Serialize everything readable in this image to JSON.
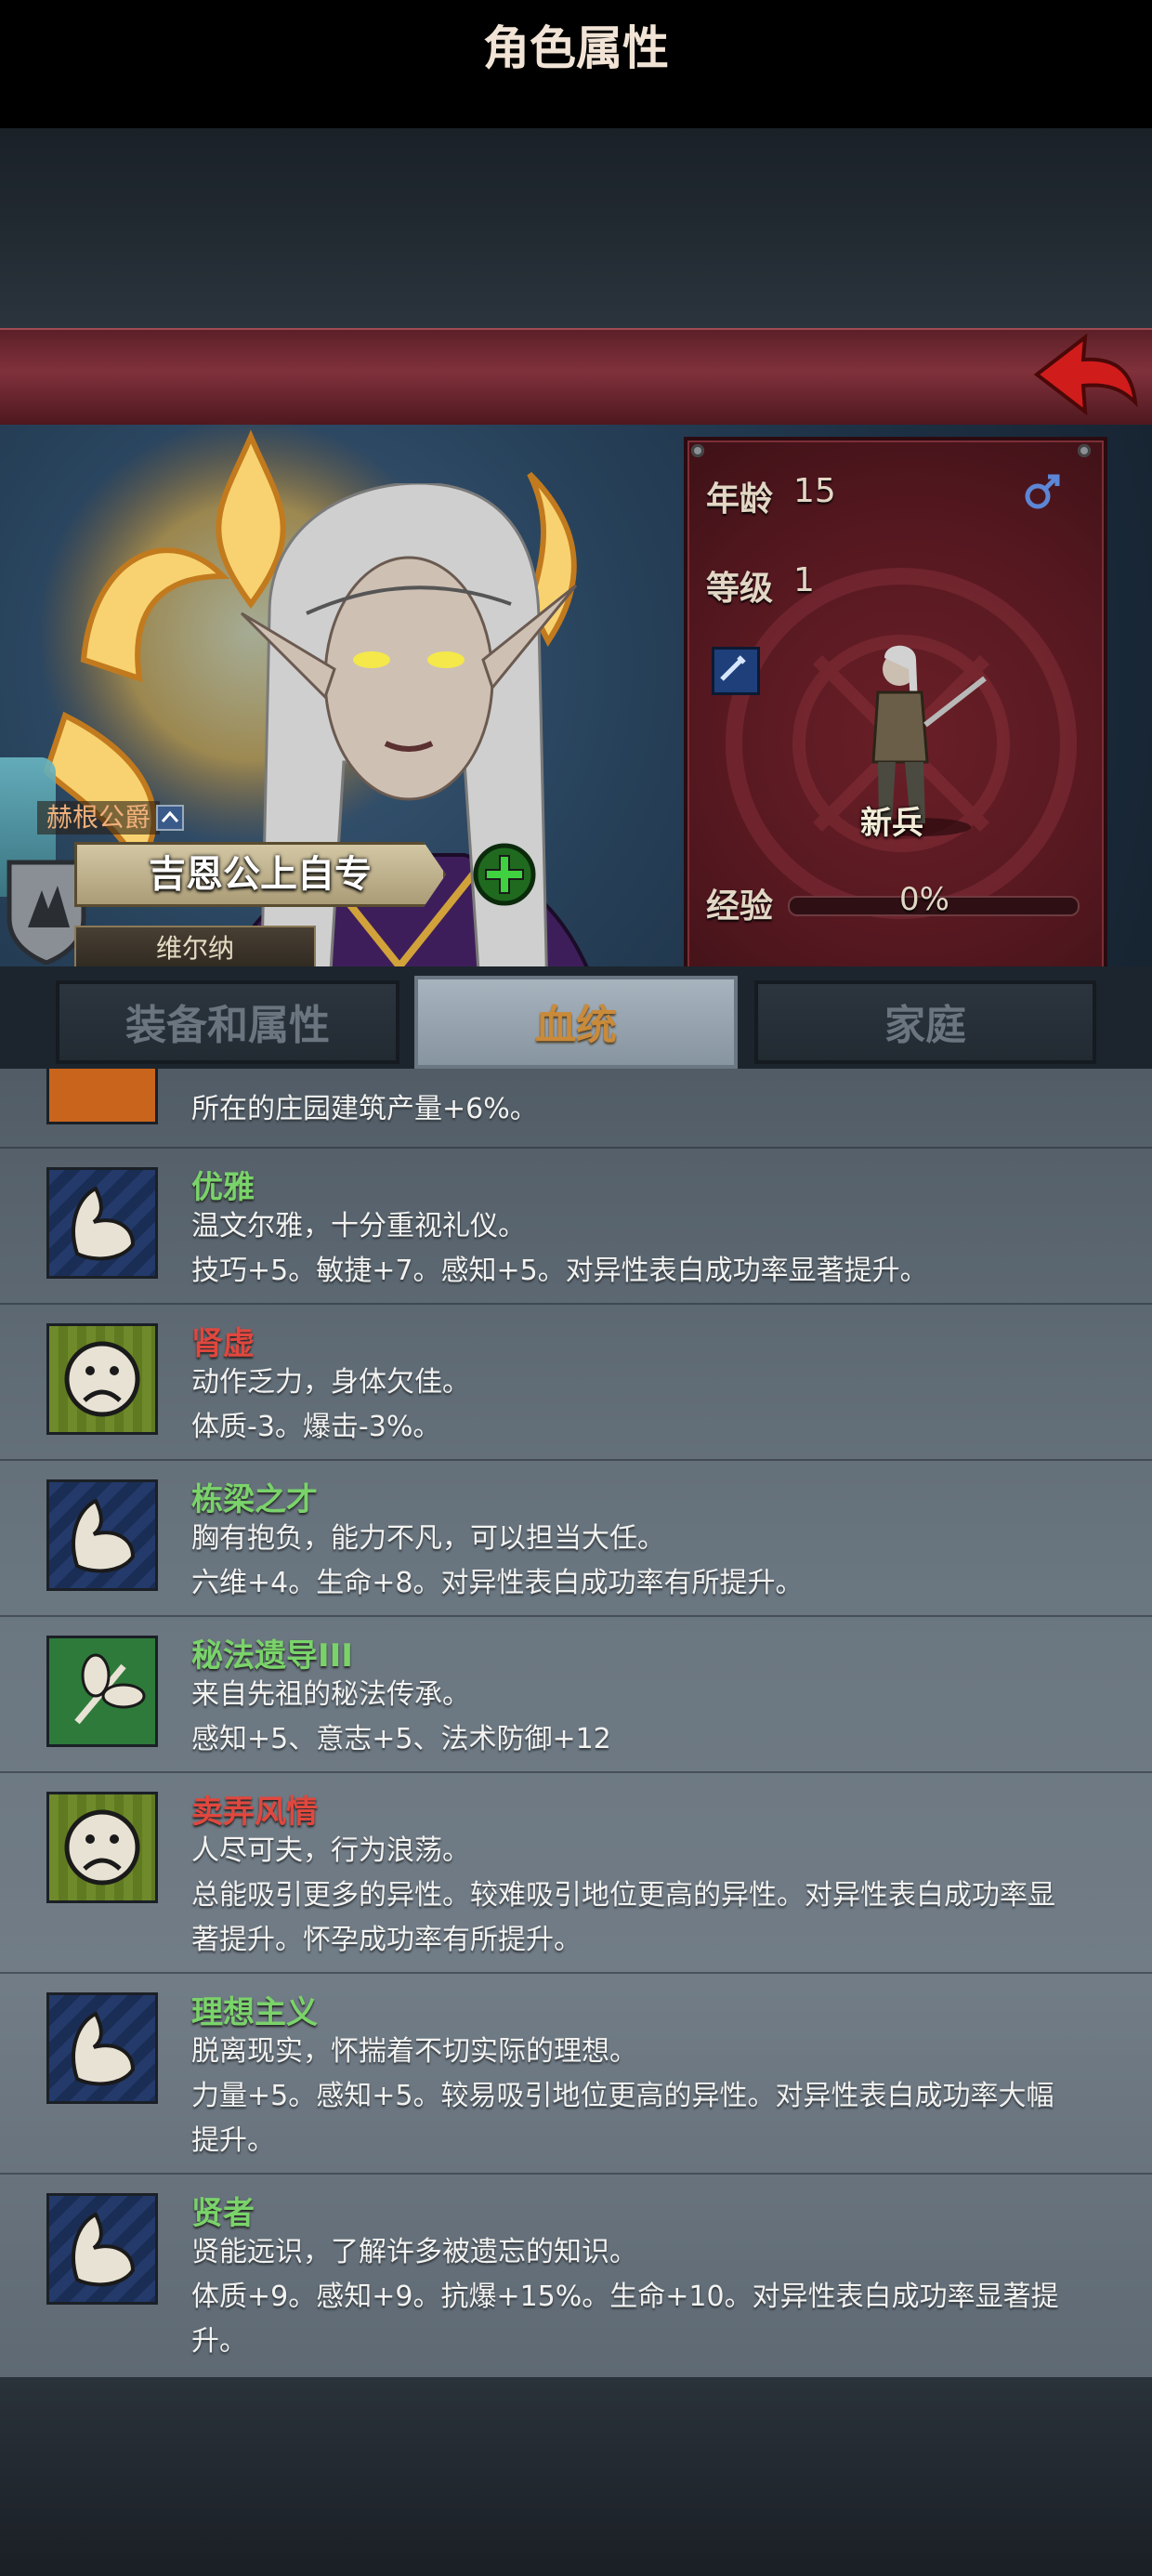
{
  "header": {
    "title": "角色属性"
  },
  "character": {
    "title": "赫根公爵",
    "name": "吉恩公上自专",
    "region": "维尔纳"
  },
  "stats": {
    "age_label": "年龄",
    "age_value": "15",
    "gender_icon": "male-icon",
    "level_label": "等级",
    "level_value": "1",
    "class_name": "新兵",
    "exp_label": "经验",
    "exp_value": "0%",
    "exp_fraction": 0
  },
  "tabs": [
    {
      "label": "装备和属性",
      "active": false
    },
    {
      "label": "血统",
      "active": true
    },
    {
      "label": "家庭",
      "active": false
    }
  ],
  "traits": [
    {
      "name": "",
      "icon": "sun-icon",
      "kind": "good",
      "lines": [
        "所在的庄园建筑产量+6%。"
      ]
    },
    {
      "name": "优雅",
      "icon": "arm-icon",
      "kind": "good",
      "lines": [
        "温文尔雅，十分重视礼仪。",
        "技巧+5。敏捷+7。感知+5。对异性表白成功率显著提升。"
      ]
    },
    {
      "name": "肾虚",
      "icon": "sad-face-icon",
      "kind": "bad",
      "lines": [
        "动作乏力，身体欠佳。",
        "体质-3。爆击-3%。"
      ]
    },
    {
      "name": "栋梁之才",
      "icon": "arm-icon",
      "kind": "good",
      "lines": [
        "胸有抱负，能力不凡，可以担当大任。",
        "六维+4。生命+8。对异性表白成功率有所提升。"
      ]
    },
    {
      "name": "秘法遗导III",
      "icon": "leaf-icon",
      "kind": "good",
      "lines": [
        "来自先祖的秘法传承。",
        "感知+5、意志+5、法术防御+12"
      ]
    },
    {
      "name": "卖弄风情",
      "icon": "sad-face-icon",
      "kind": "bad",
      "lines": [
        "人尽可夫，行为浪荡。",
        "总能吸引更多的异性。较难吸引地位更高的异性。对异性表白成功率显",
        "著提升。怀孕成功率有所提升。"
      ]
    },
    {
      "name": "理想主义",
      "icon": "arm-icon",
      "kind": "good",
      "lines": [
        "脱离现实，怀揣着不切实际的理想。",
        "力量+5。感知+5。较易吸引地位更高的异性。对异性表白成功率大幅",
        "提升。"
      ]
    },
    {
      "name": "贤者",
      "icon": "arm-icon",
      "kind": "good",
      "lines": [
        "贤能远识，了解许多被遗忘的知识。",
        "体质+9。感知+9。抗爆+15%。生命+10。对异性表白成功率显著提",
        "升。"
      ]
    }
  ]
}
